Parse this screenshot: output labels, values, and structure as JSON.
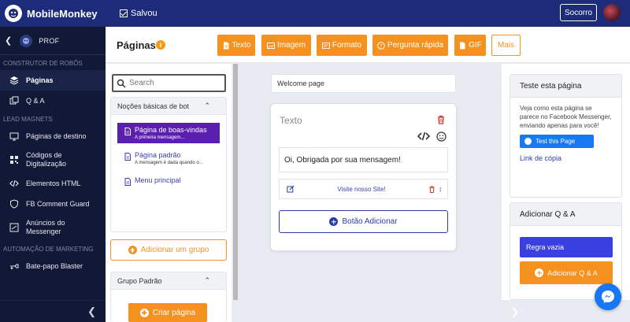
{
  "app": {
    "brand": "MobileMonkey",
    "saved_label": "Salvou",
    "help_label": "Socorro"
  },
  "sidebar": {
    "back_icon": "chevron-left-icon",
    "project_name": "PROF",
    "sections": [
      {
        "title": "CONSTRUTOR DE ROBÔS",
        "items": [
          {
            "label": "Páginas",
            "icon": "layers-icon",
            "active": true
          },
          {
            "label": "Q & A",
            "icon": "copy-icon",
            "active": false
          }
        ]
      },
      {
        "title": "LEAD MAGNETS",
        "items": [
          {
            "label": "Páginas de destino",
            "icon": "monitor-icon"
          },
          {
            "label": "Códigos de Digitalização",
            "icon": "qr-code-icon"
          },
          {
            "label": "Elementos HTML",
            "icon": "code-icon"
          },
          {
            "label": "FB Comment Guard",
            "icon": "shield-icon"
          },
          {
            "label": "Anúncios do Messenger",
            "icon": "megaphone-icon"
          }
        ]
      },
      {
        "title": "AUTOMAÇÃO DE MARKETING",
        "items": [
          {
            "label": "Bate-papo Blaster",
            "icon": "blaster-icon"
          }
        ]
      }
    ],
    "collapse_icon": "chevron-left-icon"
  },
  "header": {
    "title": "Páginas",
    "toolbar": [
      {
        "label": "Texto",
        "icon": "text-file-icon"
      },
      {
        "label": "Imagem",
        "icon": "image-icon"
      },
      {
        "label": "Formato",
        "icon": "form-icon"
      },
      {
        "label": "Pergunta rápida",
        "icon": "question-icon"
      },
      {
        "label": "GIF",
        "icon": "gif-file-icon"
      }
    ],
    "more_label": "Mais"
  },
  "blocks": {
    "search_placeholder": "Search",
    "group1": {
      "title": "Noções básicas de bot",
      "pages": [
        {
          "title": "Página de boas-vindas",
          "subtitle": "A primeira mensagem...",
          "selected": true
        },
        {
          "title": "Página padrão",
          "subtitle": "A mensagem é dada quando o...",
          "selected": false
        },
        {
          "title": "Menu principal",
          "subtitle": "",
          "selected": false
        }
      ]
    },
    "add_group_label": "Adicionar um grupo",
    "group2": {
      "title": "Grupo Padrão"
    },
    "create_page_label": "Criar página"
  },
  "canvas": {
    "page_name": "Welcome page",
    "card_title": "Texto",
    "message": "Oi, Obrigada por sua mensagem!",
    "button_label": "Visite nosso Site!",
    "add_button_label": "Botão Adicionar"
  },
  "right": {
    "test": {
      "title": "Teste esta página",
      "description": "Veja como esta página se parece no Facebook Messenger, enviando apenas para você!",
      "button_label": "Test this Page",
      "link_label": "Link de cópia"
    },
    "qa": {
      "title": "Adicionar Q & A",
      "rule_label": "Regra vazia",
      "add_label": "Adicionar Q & A"
    }
  },
  "colors": {
    "topbar": "#1c2b7a",
    "sidebar": "#111936",
    "accent_orange": "#f5911e",
    "selected_purple": "#5b1fb0",
    "link_blue": "#2a3ca8",
    "messenger_blue": "#1877f2"
  }
}
